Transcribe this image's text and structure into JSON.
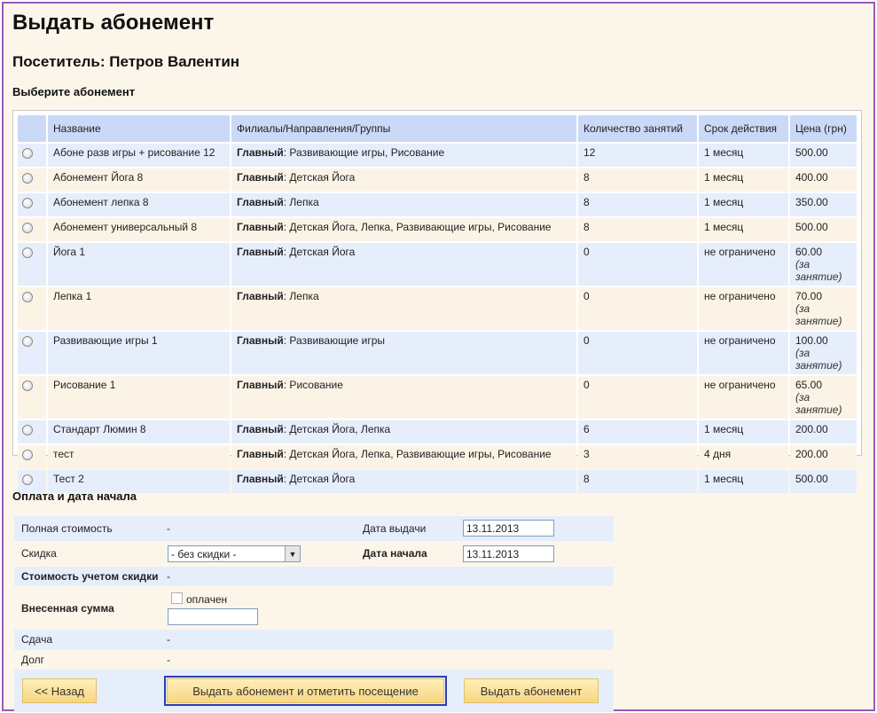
{
  "page": {
    "title": "Выдать абонемент",
    "visitor": "Посетитель: Петров Валентин",
    "choose_section": "Выберите абонемент",
    "payment_section": "Оплата и дата начала"
  },
  "table": {
    "headers": [
      "Название",
      "Филиалы/Направления/Группы",
      "Количество занятий",
      "Срок действия",
      "Цена (грн)"
    ],
    "rows": [
      {
        "name": "Абоне разв игры + рисование 12",
        "branch": "Главный",
        "groups": ": Развивающие игры, Рисование",
        "count": "12",
        "term": "1 месяц",
        "price": "500.00",
        "price_note": ""
      },
      {
        "name": "Абонемент Йога 8",
        "branch": "Главный",
        "groups": ": Детская Йога",
        "count": "8",
        "term": "1 месяц",
        "price": "400.00",
        "price_note": ""
      },
      {
        "name": "Абонемент лепка 8",
        "branch": "Главный",
        "groups": ": Лепка",
        "count": "8",
        "term": "1 месяц",
        "price": "350.00",
        "price_note": ""
      },
      {
        "name": "Абонемент универсальный 8",
        "branch": "Главный",
        "groups": ": Детская Йога, Лепка, Развивающие игры, Рисование",
        "count": "8",
        "term": "1 месяц",
        "price": "500.00",
        "price_note": ""
      },
      {
        "name": "Йога 1",
        "branch": "Главный",
        "groups": ": Детская Йога",
        "count": "0",
        "term": "не ограничено",
        "price": "60.00",
        "price_note": "(за занятие)"
      },
      {
        "name": "Лепка 1",
        "branch": "Главный",
        "groups": ": Лепка",
        "count": "0",
        "term": "не ограничено",
        "price": "70.00",
        "price_note": "(за занятие)"
      },
      {
        "name": "Развивающие игры 1",
        "branch": "Главный",
        "groups": ": Развивающие игры",
        "count": "0",
        "term": "не ограничено",
        "price": "100.00",
        "price_note": "(за занятие)"
      },
      {
        "name": "Рисование 1",
        "branch": "Главный",
        "groups": ": Рисование",
        "count": "0",
        "term": "не ограничено",
        "price": "65.00",
        "price_note": "(за занятие)"
      },
      {
        "name": "Стандарт Люмин 8",
        "branch": "Главный",
        "groups": ": Детская Йога, Лепка",
        "count": "6",
        "term": "1 месяц",
        "price": "200.00",
        "price_note": ""
      },
      {
        "name": "тест",
        "branch": "Главный",
        "groups": ": Детская Йога, Лепка, Развивающие игры, Рисование",
        "count": "3",
        "term": "4 дня",
        "price": "200.00",
        "price_note": ""
      },
      {
        "name": "Тест 2",
        "branch": "Главный",
        "groups": ": Детская Йога",
        "count": "8",
        "term": "1 месяц",
        "price": "500.00",
        "price_note": ""
      }
    ]
  },
  "payment": {
    "full_cost_label": "Полная стоимость",
    "full_cost_value": "-",
    "issue_date_label": "Дата выдачи",
    "issue_date_value": "13.11.2013",
    "discount_label": "Скидка",
    "discount_value": "- без скидки -",
    "start_date_label": "Дата начала",
    "start_date_value": "13.11.2013",
    "discounted_cost_label": "Стоимость учетом скидки",
    "discounted_cost_value": "-",
    "paid_label": "Внесенная сумма",
    "paid_checkbox_label": "оплачен",
    "paid_value": "",
    "change_label": "Сдача",
    "change_value": "-",
    "debt_label": "Долг",
    "debt_value": "-"
  },
  "buttons": {
    "back": "<< Назад",
    "issue_and_mark": "Выдать абонемент и отметить посещение",
    "issue": "Выдать абонемент"
  },
  "colors": {
    "frame_border": "#9b59b6",
    "header_bg": "#c9d9f7",
    "row_blue": "#e6eefc",
    "row_cream": "#fbf4e6",
    "button": "#f7d683",
    "focus_outline": "#2c3fb0"
  }
}
